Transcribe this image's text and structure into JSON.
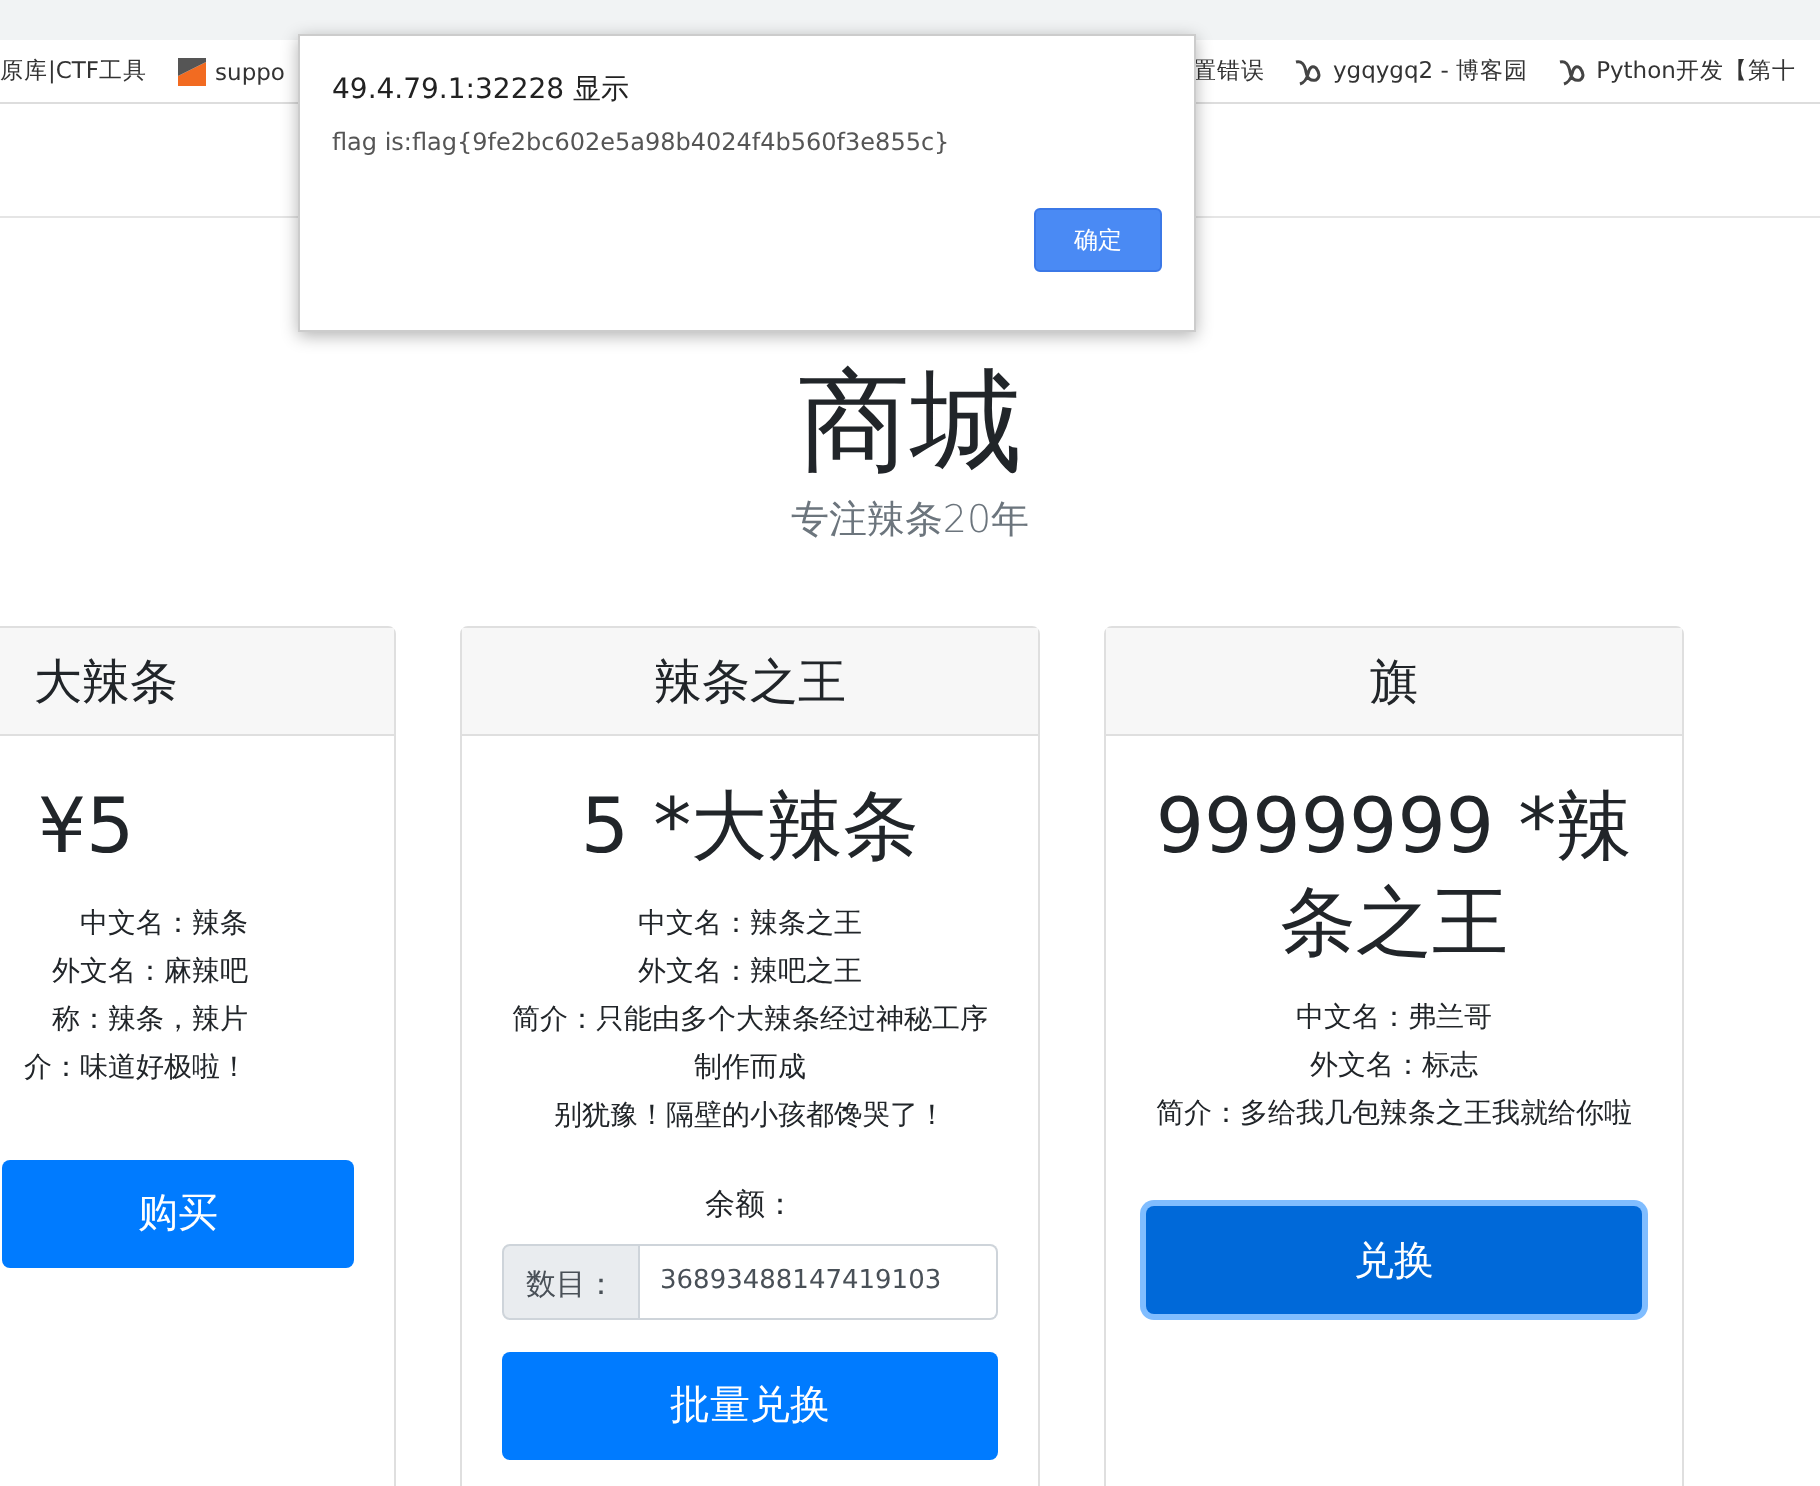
{
  "bookmarks": [
    {
      "label": "原库|CTF工具",
      "kind": "plain"
    },
    {
      "label": "suppo",
      "kind": "logo"
    },
    {
      "label": "置错误",
      "kind": "plain"
    },
    {
      "label": "ygqygq2 - 博客园",
      "kind": "blog"
    },
    {
      "label": "Python开发【第十",
      "kind": "blog"
    }
  ],
  "dialog": {
    "title": "49.4.79.1:32228 显示",
    "message": "flag is:flag{9fe2bc602e5a98b4024f4b560f3e855c}",
    "button": "确定"
  },
  "hero": {
    "title": "商城",
    "subtitle": "专注辣条20年"
  },
  "cards": [
    {
      "header": "大辣条",
      "price": "¥5",
      "cut_off_left": true,
      "lines": [
        "中文名：辣条",
        "外文名：麻辣吧",
        "称：辣条，辣片",
        "介：味道好极啦！"
      ],
      "button": {
        "label": "购买",
        "focused": false
      }
    },
    {
      "header": "辣条之王",
      "price": "5 *大辣条",
      "cut_off_left": false,
      "lines": [
        "中文名：辣条之王",
        "外文名：辣吧之王",
        "简介：只能由多个大辣条经过神秘工序制作而成",
        "别犹豫！隔壁的小孩都馋哭了！"
      ],
      "balance_label": "余额：",
      "quantity": {
        "label": "数目：",
        "value": "36893488147419103"
      },
      "button": {
        "label": "批量兑换",
        "focused": false
      }
    },
    {
      "header": "旗",
      "price": "9999999 *辣条之王",
      "cut_off_left": false,
      "lines": [
        "中文名：弗兰哥",
        "外文名：标志",
        "简介：多给我几包辣条之王我就给你啦"
      ],
      "button": {
        "label": "兑换",
        "focused": true
      }
    }
  ]
}
